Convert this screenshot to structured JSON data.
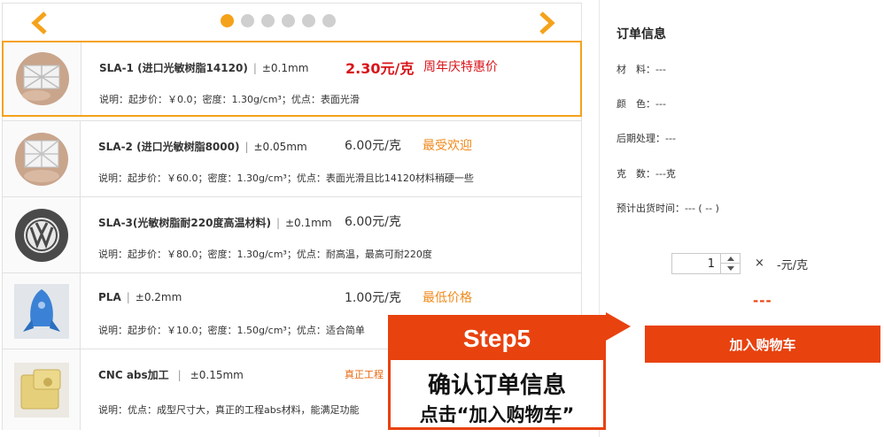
{
  "carousel": {
    "prev_icon": "chevron-left-icon",
    "next_icon": "chevron-right-icon",
    "page_count": 6,
    "active_page": 1
  },
  "materials": [
    {
      "name": "SLA-1 (进口光敏树脂14120)",
      "tolerance": "±0.1mm",
      "price": "2.30元/克",
      "tag": "周年庆特惠价",
      "desc": "说明：起步价：￥0.0；密度：1.30g/cm³；优点：表面光滑",
      "thumbnail": "white-lattice-part-photo",
      "selected": true
    },
    {
      "name": "SLA-2 (进口光敏树脂8000)",
      "tolerance": "±0.05mm",
      "price": "6.00元/克",
      "tag": "最受欢迎",
      "desc": "说明：起步价：￥60.0；密度：1.30g/cm³；优点：表面光滑且比14120材料稍硬一些",
      "thumbnail": "white-lattice-part-photo",
      "selected": false
    },
    {
      "name": "SLA-3(光敏树脂耐220度高温材料)",
      "tolerance": "±0.1mm",
      "price": "6.00元/克",
      "tag": "",
      "desc": "说明：起步价：￥80.0；密度：1.30g/cm³；优点：耐高温，最高可耐220度",
      "thumbnail": "vw-logo-wheel-photo",
      "selected": false
    },
    {
      "name": "PLA",
      "tolerance": "±0.2mm",
      "price": "1.00元/克",
      "tag": "最低价格",
      "desc": "说明：起步价：￥10.0；密度：1.50g/cm³；优点：适合简单",
      "thumbnail": "blue-rocket-model-photo",
      "selected": false
    },
    {
      "name": "CNC abs加工",
      "tolerance": "±0.15mm",
      "price": "",
      "tag": "真正工程",
      "desc": "说明：优点：成型尺寸大，真正的工程abs材料，能满足功能",
      "thumbnail": "beige-abs-part-photo",
      "selected": false
    }
  ],
  "order": {
    "title": "订单信息",
    "material": "材　料：---",
    "color": "颜　色：---",
    "post_process": "后期处理：---",
    "weight": "克　数：---克",
    "ship_time": "预计出货时间：--- ( -- )",
    "quantity": "1",
    "times_sign": "×",
    "unit_price": "-元/克",
    "total": "---",
    "add_to_cart": "加入购物车"
  },
  "callout": {
    "step": "Step5",
    "line1": "确认订单信息",
    "line2": "点击“加入购物车”"
  },
  "colors": {
    "accent_orange": "#f5a21b",
    "cta_red_orange": "#e8420f",
    "promo_red": "#d8141a",
    "tag_orange": "#f08a1d"
  }
}
